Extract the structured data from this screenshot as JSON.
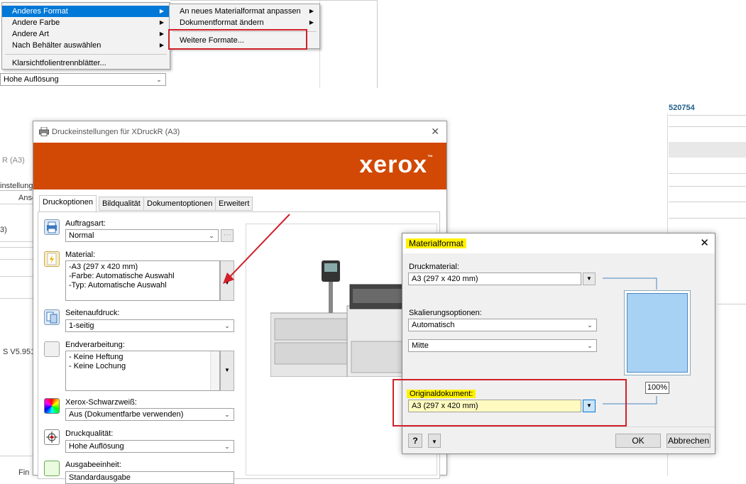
{
  "top_menu": {
    "items": [
      {
        "label": "Anderes Format",
        "submenu": true,
        "selected": true
      },
      {
        "label": "Andere Farbe",
        "submenu": true
      },
      {
        "label": "Andere Art",
        "submenu": true
      },
      {
        "label": "Nach Behälter auswählen",
        "submenu": true
      },
      {
        "label": "Klarsichtfolientrennblätter..."
      }
    ],
    "sub_items": [
      {
        "label": "An neues Materialformat anpassen",
        "submenu": true
      },
      {
        "label": "Dokumentformat ändern",
        "submenu": true
      },
      {
        "label": "Weitere Formate..."
      }
    ],
    "bg_combo_value": "Hohe Auflösung"
  },
  "background": {
    "left_texts": [
      "R (A3)",
      "instellunge",
      "Ansc",
      "3)",
      "S V5.951",
      "Fin"
    ],
    "right_text": "520754"
  },
  "print_dialog": {
    "title": "Druckeinstellungen für XDruckR (A3)",
    "close_glyph": "✕",
    "brand": "xerox",
    "brand_tm": "™",
    "tabs": [
      "Druckoptionen",
      "Bildqualität",
      "Dokumentoptionen",
      "Erweitert"
    ],
    "job_type": {
      "label": "Auftragsart:",
      "value": "Normal",
      "more": "···"
    },
    "material": {
      "label": "Material:",
      "lines": [
        "-A3 (297 x 420 mm)",
        "-Farbe: Automatische Auswahl",
        "-Typ: Automatische Auswahl"
      ]
    },
    "sides": {
      "label": "Seitenaufdruck:",
      "value": "1-seitig"
    },
    "finishing": {
      "label": "Endverarbeitung:",
      "lines": [
        "- Keine Heftung",
        "- Keine Lochung"
      ]
    },
    "bw": {
      "label": "Xerox-Schwarzweiß:",
      "value": "Aus (Dokumentfarbe verwenden)"
    },
    "quality": {
      "label": "Druckqualität:",
      "value": "Hohe Auflösung"
    },
    "output": {
      "label": "Ausgabeeinheit:",
      "value": "Standardausgabe"
    }
  },
  "material_dialog": {
    "title": "Materialformat",
    "close_glyph": "✕",
    "druckmaterial": {
      "label": "Druckmaterial:",
      "value": "A3 (297 x 420 mm)"
    },
    "skalierung": {
      "label": "Skalierungsoptionen:",
      "value": "Automatisch",
      "position": "Mitte"
    },
    "original": {
      "label": "Originaldokument:",
      "value": "A3 (297 x 420 mm)"
    },
    "zoom": "100%",
    "help_label": "?",
    "ok_label": "OK",
    "cancel_label": "Abbrechen"
  },
  "colors": {
    "xerox_orange": "#d14905",
    "highlight": "#fff200",
    "annotation_red": "#d0202a",
    "menu_selection": "#0078d7",
    "paper_preview": "#a8d2f4"
  }
}
